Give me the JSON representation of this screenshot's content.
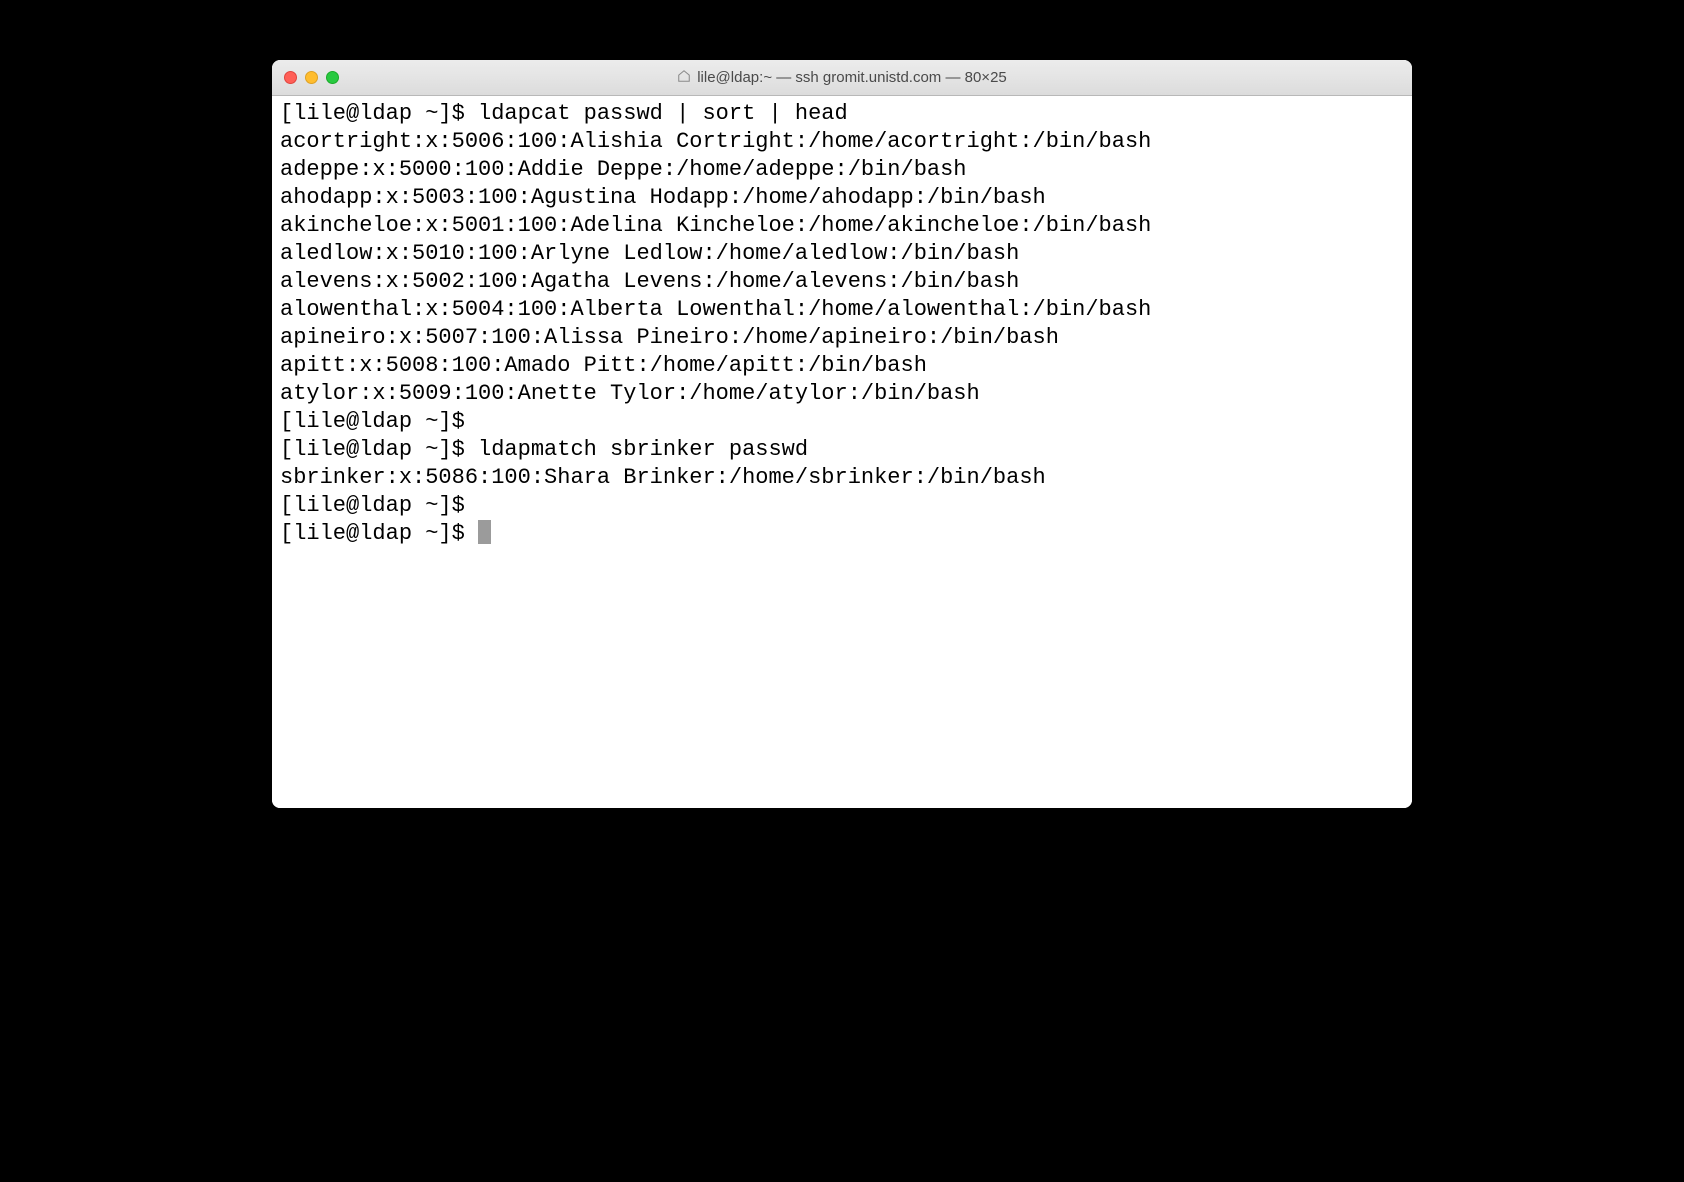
{
  "window": {
    "title": "lile@ldap:~ — ssh gromit.unistd.com — 80×25"
  },
  "terminal": {
    "prompt": "[lile@ldap ~]$ ",
    "lines": [
      "[lile@ldap ~]$ ldapcat passwd | sort | head",
      "acortright:x:5006:100:Alishia Cortright:/home/acortright:/bin/bash",
      "adeppe:x:5000:100:Addie Deppe:/home/adeppe:/bin/bash",
      "ahodapp:x:5003:100:Agustina Hodapp:/home/ahodapp:/bin/bash",
      "akincheloe:x:5001:100:Adelina Kincheloe:/home/akincheloe:/bin/bash",
      "aledlow:x:5010:100:Arlyne Ledlow:/home/aledlow:/bin/bash",
      "alevens:x:5002:100:Agatha Levens:/home/alevens:/bin/bash",
      "alowenthal:x:5004:100:Alberta Lowenthal:/home/alowenthal:/bin/bash",
      "apineiro:x:5007:100:Alissa Pineiro:/home/apineiro:/bin/bash",
      "apitt:x:5008:100:Amado Pitt:/home/apitt:/bin/bash",
      "atylor:x:5009:100:Anette Tylor:/home/atylor:/bin/bash",
      "[lile@ldap ~]$ ",
      "[lile@ldap ~]$ ldapmatch sbrinker passwd",
      "sbrinker:x:5086:100:Shara Brinker:/home/sbrinker:/bin/bash",
      "[lile@ldap ~]$ "
    ],
    "current_prompt": "[lile@ldap ~]$ "
  }
}
